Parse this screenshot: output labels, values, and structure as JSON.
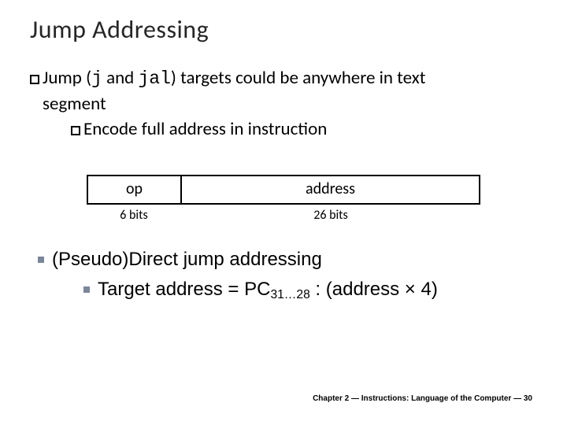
{
  "title": "Jump Addressing",
  "l1_pre": "Jump (",
  "code_j": "j",
  "l1_mid": " and ",
  "code_jal": "jal",
  "l1_post": ") targets could be anywhere in text",
  "l2": "segment",
  "l3": "Encode full address in instruction",
  "diagram": {
    "op": "op",
    "addr": "address",
    "op_bits": "6 bits",
    "addr_bits": "26 bits"
  },
  "p1": "(Pseudo)Direct jump addressing",
  "p2_pre": "Target address = PC",
  "p2_sub": "31…28",
  "p2_post": " : (address × 4)",
  "footer": "Chapter 2 — Instructions: Language of the Computer — 30"
}
